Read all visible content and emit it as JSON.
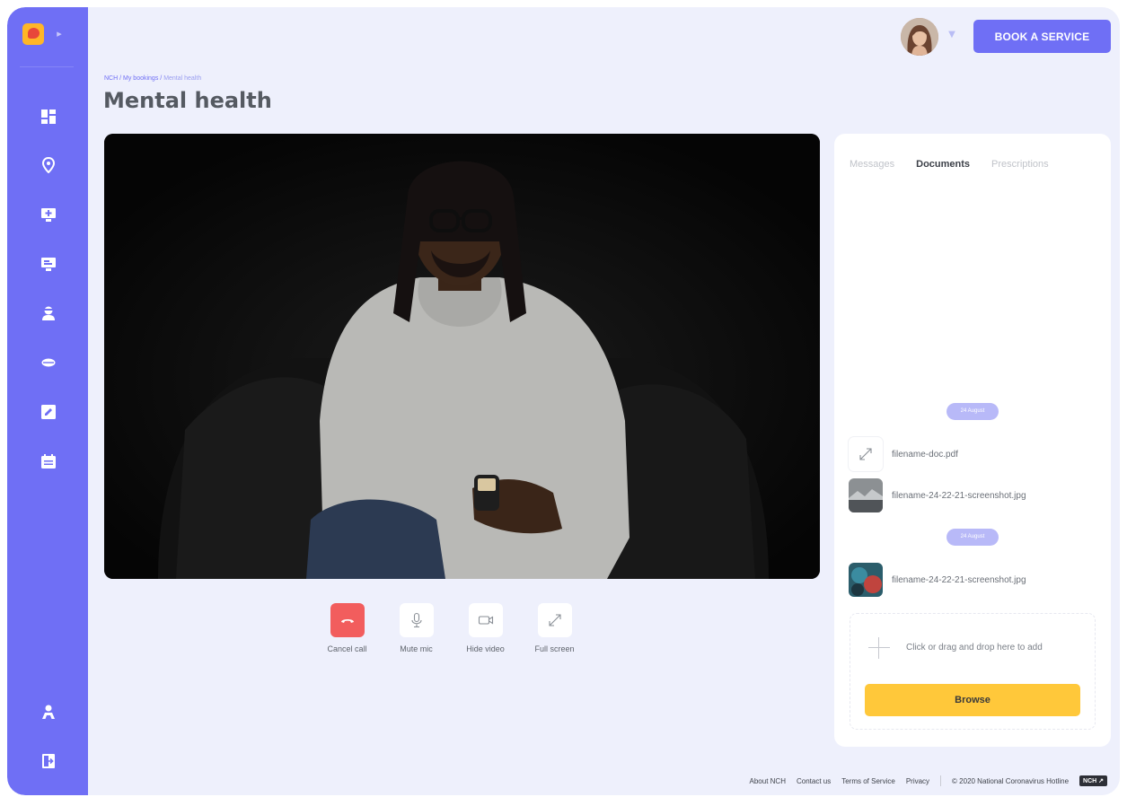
{
  "sidebar": {
    "logo_icon": "app-logo-icon",
    "expand_icon": "chevron-right-icon",
    "items": [
      {
        "name": "dashboard-icon"
      },
      {
        "name": "location-icon"
      },
      {
        "name": "medical-screen-icon"
      },
      {
        "name": "monitor-chat-icon"
      },
      {
        "name": "doctor-icon"
      },
      {
        "name": "pill-icon"
      },
      {
        "name": "edit-icon"
      },
      {
        "name": "calendar-icon"
      }
    ],
    "bottom_items": [
      {
        "name": "user-icon"
      },
      {
        "name": "logout-icon"
      }
    ]
  },
  "header": {
    "book_button": "Book a service"
  },
  "breadcrumb": {
    "items": [
      "NCH",
      "My bookings",
      "Mental health"
    ],
    "separator": "/"
  },
  "page_title": "Mental health",
  "controls": [
    {
      "name": "cancel-call",
      "label": "Cancel call",
      "icon": "phone-hangup-icon"
    },
    {
      "name": "mute-mic",
      "label": "Mute mic",
      "icon": "microphone-icon"
    },
    {
      "name": "hide-video",
      "label": "Hide video",
      "icon": "video-camera-icon"
    },
    {
      "name": "full-screen",
      "label": "Full screen",
      "icon": "expand-icon"
    }
  ],
  "panel": {
    "tabs": [
      "Messages",
      "Documents",
      "Prescriptions"
    ],
    "active_tab": "Documents",
    "groups": [
      {
        "date": "24 August",
        "files": [
          {
            "name": "filename-doc.pdf",
            "thumb": "document-expand-icon"
          },
          {
            "name": "filename-24-22-21-screenshot.jpg",
            "thumb": "image-thumbnail"
          }
        ]
      },
      {
        "date": "24 August",
        "files": [
          {
            "name": "filename-24-22-21-screenshot.jpg",
            "thumb": "image-thumbnail"
          }
        ]
      }
    ],
    "dropzone_text": "Click or drag and drop here to add",
    "browse_button": "Browse"
  },
  "footer": {
    "links": [
      "About NCH",
      "Contact us",
      "Terms of Service",
      "Privacy"
    ],
    "copyright": "© 2020 National Coronavirus Hotline",
    "badge": "NCH"
  },
  "colors": {
    "brand": "#6f6ff5",
    "background": "#eef0fc",
    "cancel": "#f25d5d",
    "browse": "#ffc83a"
  }
}
